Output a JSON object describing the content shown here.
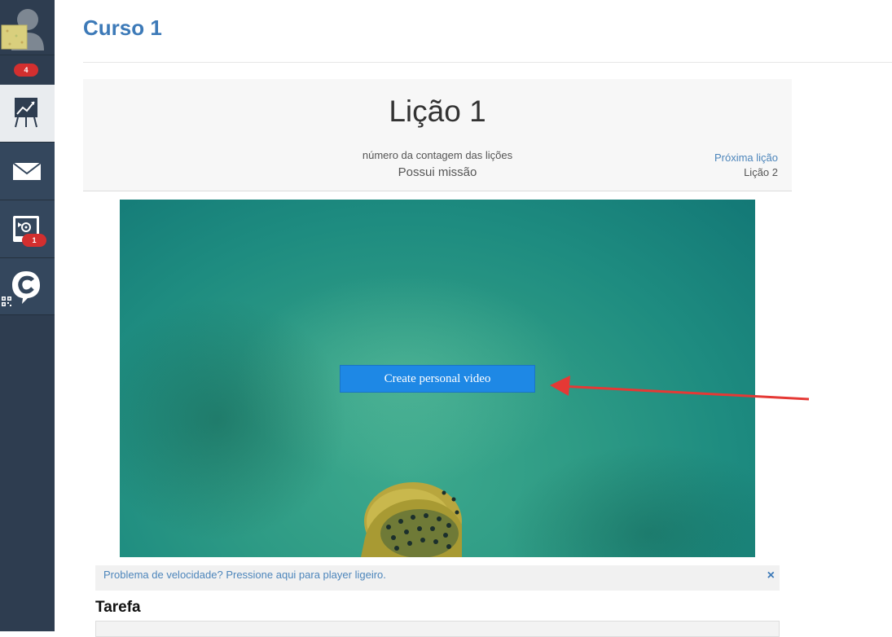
{
  "sidebar": {
    "notifications_badge": "4",
    "media_badge": "1",
    "icons": [
      "user-avatar-icon",
      "stats-board-icon",
      "mail-icon",
      "media-settings-icon",
      "chat-c-icon",
      "qr-code-icon"
    ]
  },
  "course": {
    "title": "Curso 1"
  },
  "lesson": {
    "title": "Lição 1",
    "count_label": "número da contagem das lições",
    "mission_label": "Possui missão",
    "next_label": "Próxima lição",
    "next_name": "Lição 2"
  },
  "video": {
    "cta_label": "Create personal video"
  },
  "speed_notice": {
    "text": "Problema de velocidade? Pressione aqui para player ligeiro.",
    "close": "×"
  },
  "task": {
    "heading": "Tarefa"
  },
  "colors": {
    "accent": "#3d7ab8",
    "cta": "#1e88e5",
    "badge": "#d32f2f",
    "sidebar": "#2e3d50",
    "arrow": "#e53935"
  }
}
